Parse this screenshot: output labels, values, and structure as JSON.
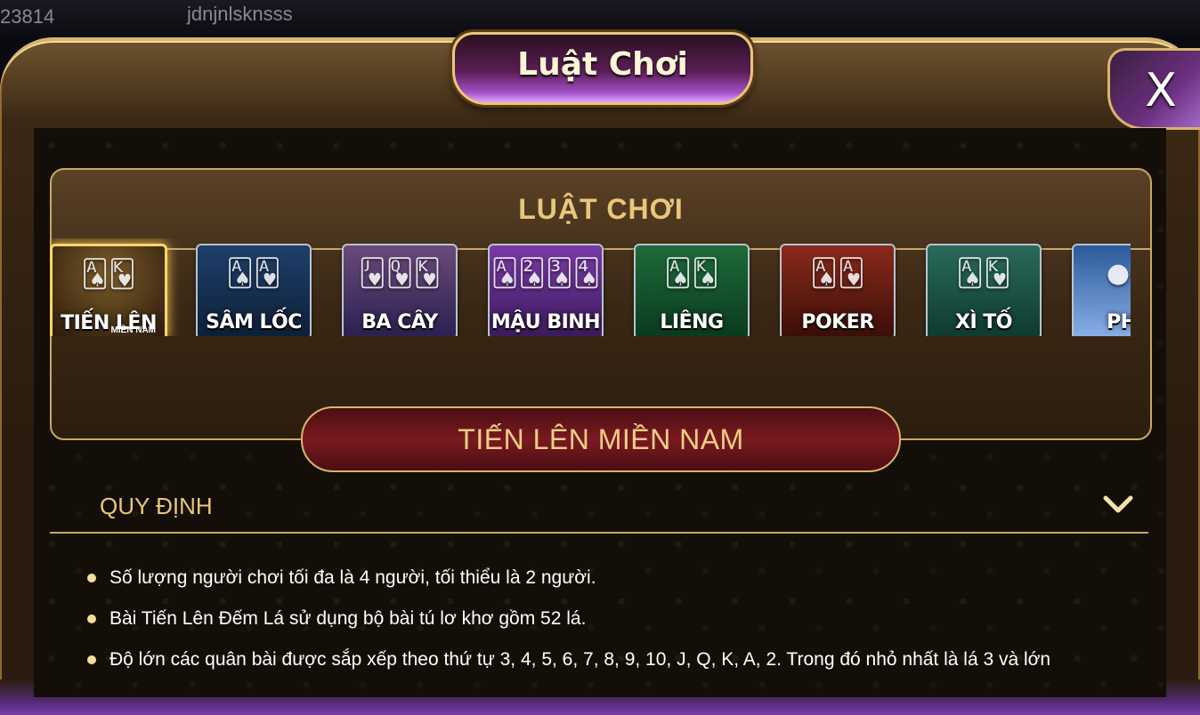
{
  "topbar": {
    "user_id": "23814",
    "username": "jdnjnlsknsss"
  },
  "dialog": {
    "title": "Luật Chơi",
    "close_label": "X"
  },
  "panel": {
    "header": "LUẬT CHƠI"
  },
  "games": [
    {
      "label": "TIẾN LÊN",
      "sub": "MIỀN NAM",
      "active": true,
      "icon": "cards-icon"
    },
    {
      "label": "SÂM LỐC",
      "sub": "",
      "active": false,
      "icon": "cards-icon"
    },
    {
      "label": "BA CÂY",
      "sub": "",
      "active": false,
      "icon": "cards-icon"
    },
    {
      "label": "MẬU BINH",
      "sub": "",
      "active": false,
      "icon": "cards-icon"
    },
    {
      "label": "LIÊNG",
      "sub": "",
      "active": false,
      "icon": "chips-icon"
    },
    {
      "label": "POKER",
      "sub": "",
      "active": false,
      "icon": "chips-icon"
    },
    {
      "label": "XÌ TỐ",
      "sub": "",
      "active": false,
      "icon": "cards-icon"
    },
    {
      "label": "PHỎ",
      "sub": "",
      "active": false,
      "icon": "coins-icon"
    }
  ],
  "selected_game": "TIẾN LÊN MIỀN NAM",
  "section": {
    "title": "QUY ĐỊNH",
    "icon": "chevron-down-icon"
  },
  "rules": [
    "Số lượng người chơi tối đa là 4 người, tối thiểu là 2 người.",
    "Bài Tiến Lên Đếm Lá sử dụng bộ bài tú lơ khơ gồm 52 lá.",
    "Độ lớn các quân bài được sắp xếp theo thứ tự 3, 4, 5, 6, 7, 8, 9, 10, J, Q, K, A, 2. Trong đó nhỏ nhất là lá 3 và lớn"
  ],
  "colors": {
    "gold": "#e9c77a",
    "frame": "#d9b46a",
    "purple": "#a34fc4",
    "banner": "#7a1a20"
  }
}
